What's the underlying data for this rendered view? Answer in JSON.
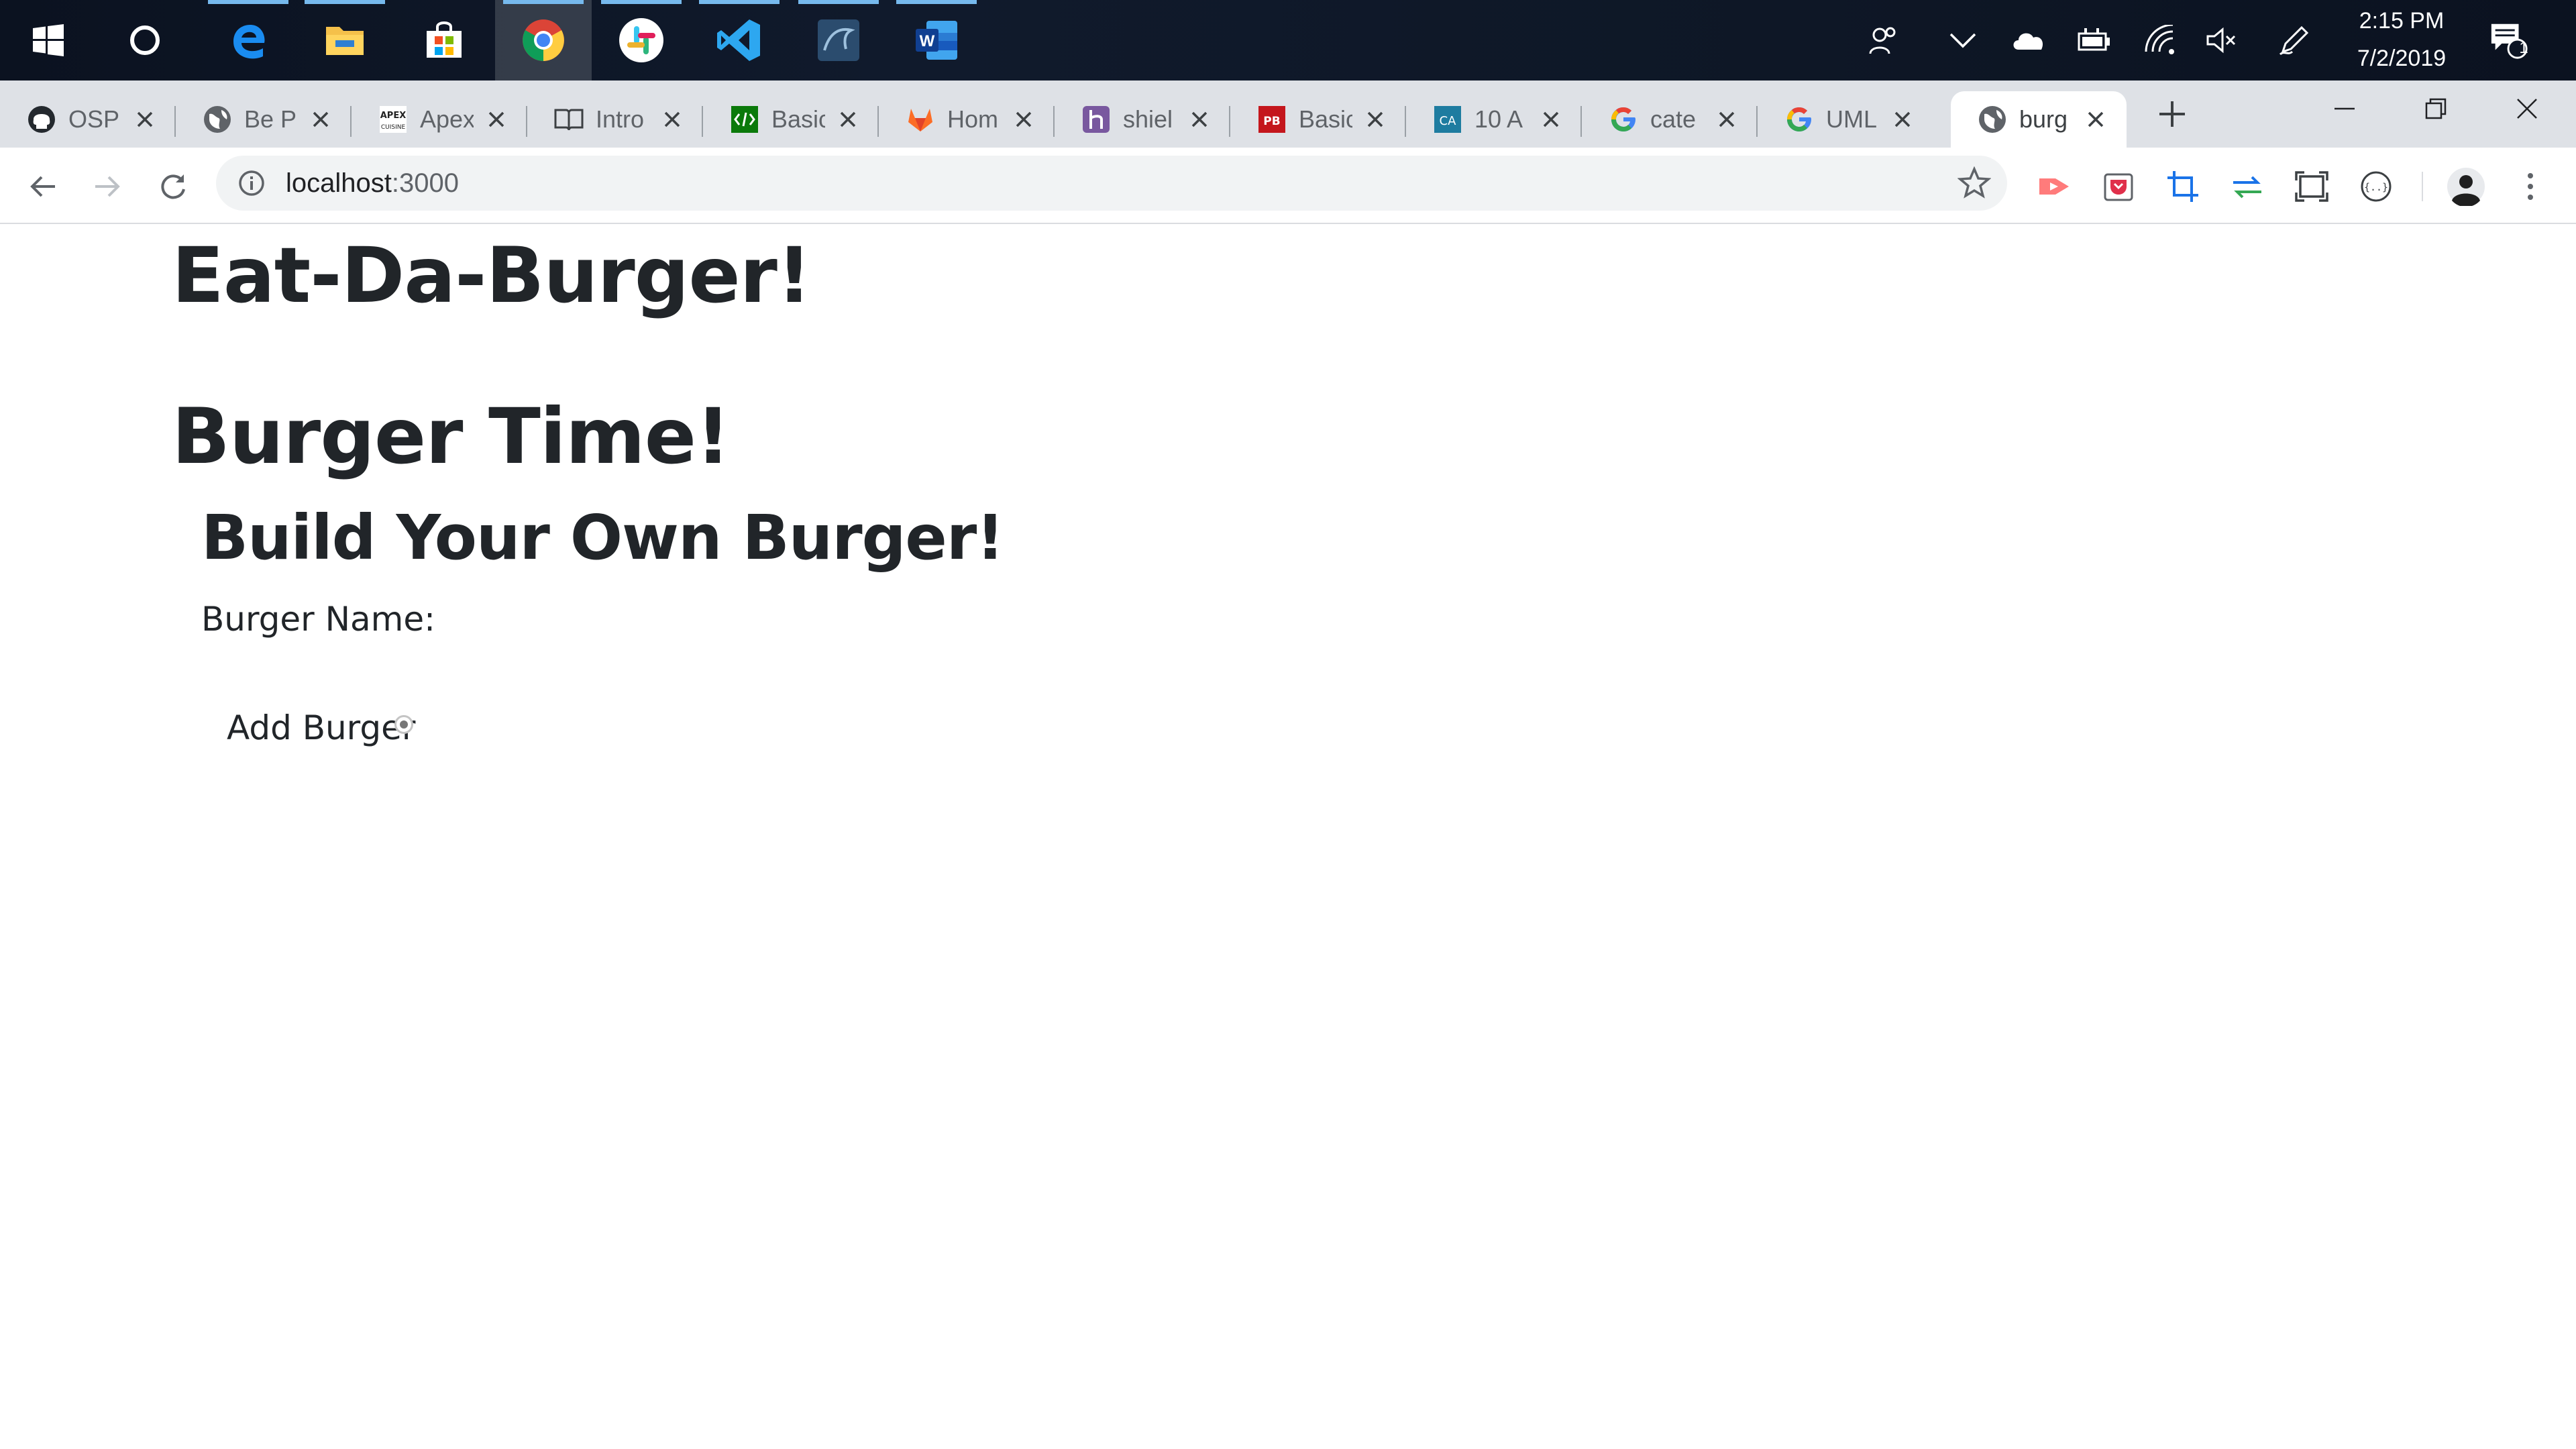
{
  "taskbar": {
    "apps": [
      {
        "name": "start",
        "icon": "windows-logo-icon"
      },
      {
        "name": "cortana",
        "icon": "cortana-circle-icon"
      },
      {
        "name": "edge",
        "icon": "edge-icon"
      },
      {
        "name": "file-explorer",
        "icon": "folder-icon"
      },
      {
        "name": "microsoft-store",
        "icon": "store-bag-icon"
      },
      {
        "name": "chrome",
        "icon": "chrome-icon",
        "active": true
      },
      {
        "name": "slack",
        "icon": "slack-icon"
      },
      {
        "name": "vscode",
        "icon": "vscode-icon"
      },
      {
        "name": "mysql-workbench",
        "icon": "mysql-workbench-icon"
      },
      {
        "name": "word",
        "icon": "word-icon"
      }
    ],
    "clock": {
      "time": "2:15 PM",
      "date": "7/2/2019"
    },
    "notification_count": "1"
  },
  "tabs": [
    {
      "title": "OSP",
      "icon": "github-icon"
    },
    {
      "title": "Be P",
      "icon": "globe-icon"
    },
    {
      "title": "Apex",
      "icon": "apex-cuisine-icon"
    },
    {
      "title": "Intro",
      "icon": "book-icon"
    },
    {
      "title": "Basic",
      "icon": "code-icon"
    },
    {
      "title": "Hom",
      "icon": "gitlab-icon"
    },
    {
      "title": "shiel",
      "icon": "heroku-icon"
    },
    {
      "title": "Basic",
      "icon": "pb-icon"
    },
    {
      "title": "10 A",
      "icon": "ca-icon"
    },
    {
      "title": "cate",
      "icon": "google-icon"
    },
    {
      "title": "UML",
      "icon": "google-icon"
    },
    {
      "title": "burg",
      "icon": "globe-icon",
      "active": true
    }
  ],
  "omnibox": {
    "host": "localhost",
    "port": ":3000"
  },
  "page": {
    "title": "Eat-Da-Burger!",
    "subtitle": "Burger Time!",
    "form_heading": "Build Your Own Burger!",
    "burger_name_label": "Burger Name:",
    "add_button": "Add Burger"
  },
  "colors": {
    "taskbar": "#0d1524",
    "tabstrip": "#dee1e6",
    "active_app_indicator": "#76b9ed",
    "heading_text": "#212529"
  }
}
